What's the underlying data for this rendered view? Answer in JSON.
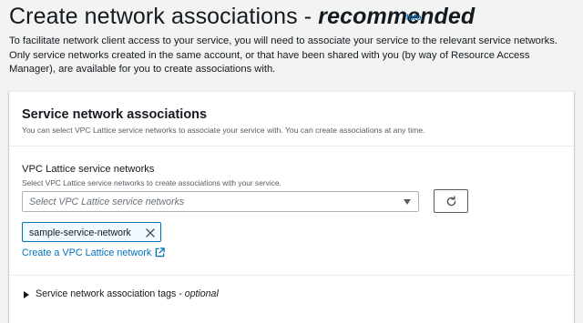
{
  "header": {
    "title_main": "Create network associations - ",
    "title_emphasis": "recommended",
    "info_label": "Info"
  },
  "intro": {
    "text": "To facilitate network client access to your service, you will need to associate your service to the relevant service networks. Only service networks created in the same account, or that have been shared with you (by way of Resource Access Manager), are available for you to create associations with."
  },
  "card": {
    "title": "Service network associations",
    "description": "You can select VPC Lattice service networks to associate your service with. You can create associations at any time.",
    "field": {
      "label": "VPC Lattice service networks",
      "description": "Select VPC Lattice service networks to create associations with your service.",
      "placeholder": "Select VPC Lattice service networks"
    },
    "selected_tokens": [
      {
        "label": "sample-service-network"
      }
    ],
    "create_link": "Create a VPC Lattice network",
    "expander": {
      "label": "Service network association tags - ",
      "optional": "optional"
    }
  },
  "icons": {
    "refresh": "refresh-icon",
    "dismiss": "close-icon",
    "external": "external-link-icon",
    "dropdown": "caret-down-icon",
    "expand": "caret-right-icon"
  },
  "colors": {
    "link": "#0073bb",
    "background": "#f2f3f3",
    "text": "#16191f",
    "secondary_text": "#545b64"
  }
}
